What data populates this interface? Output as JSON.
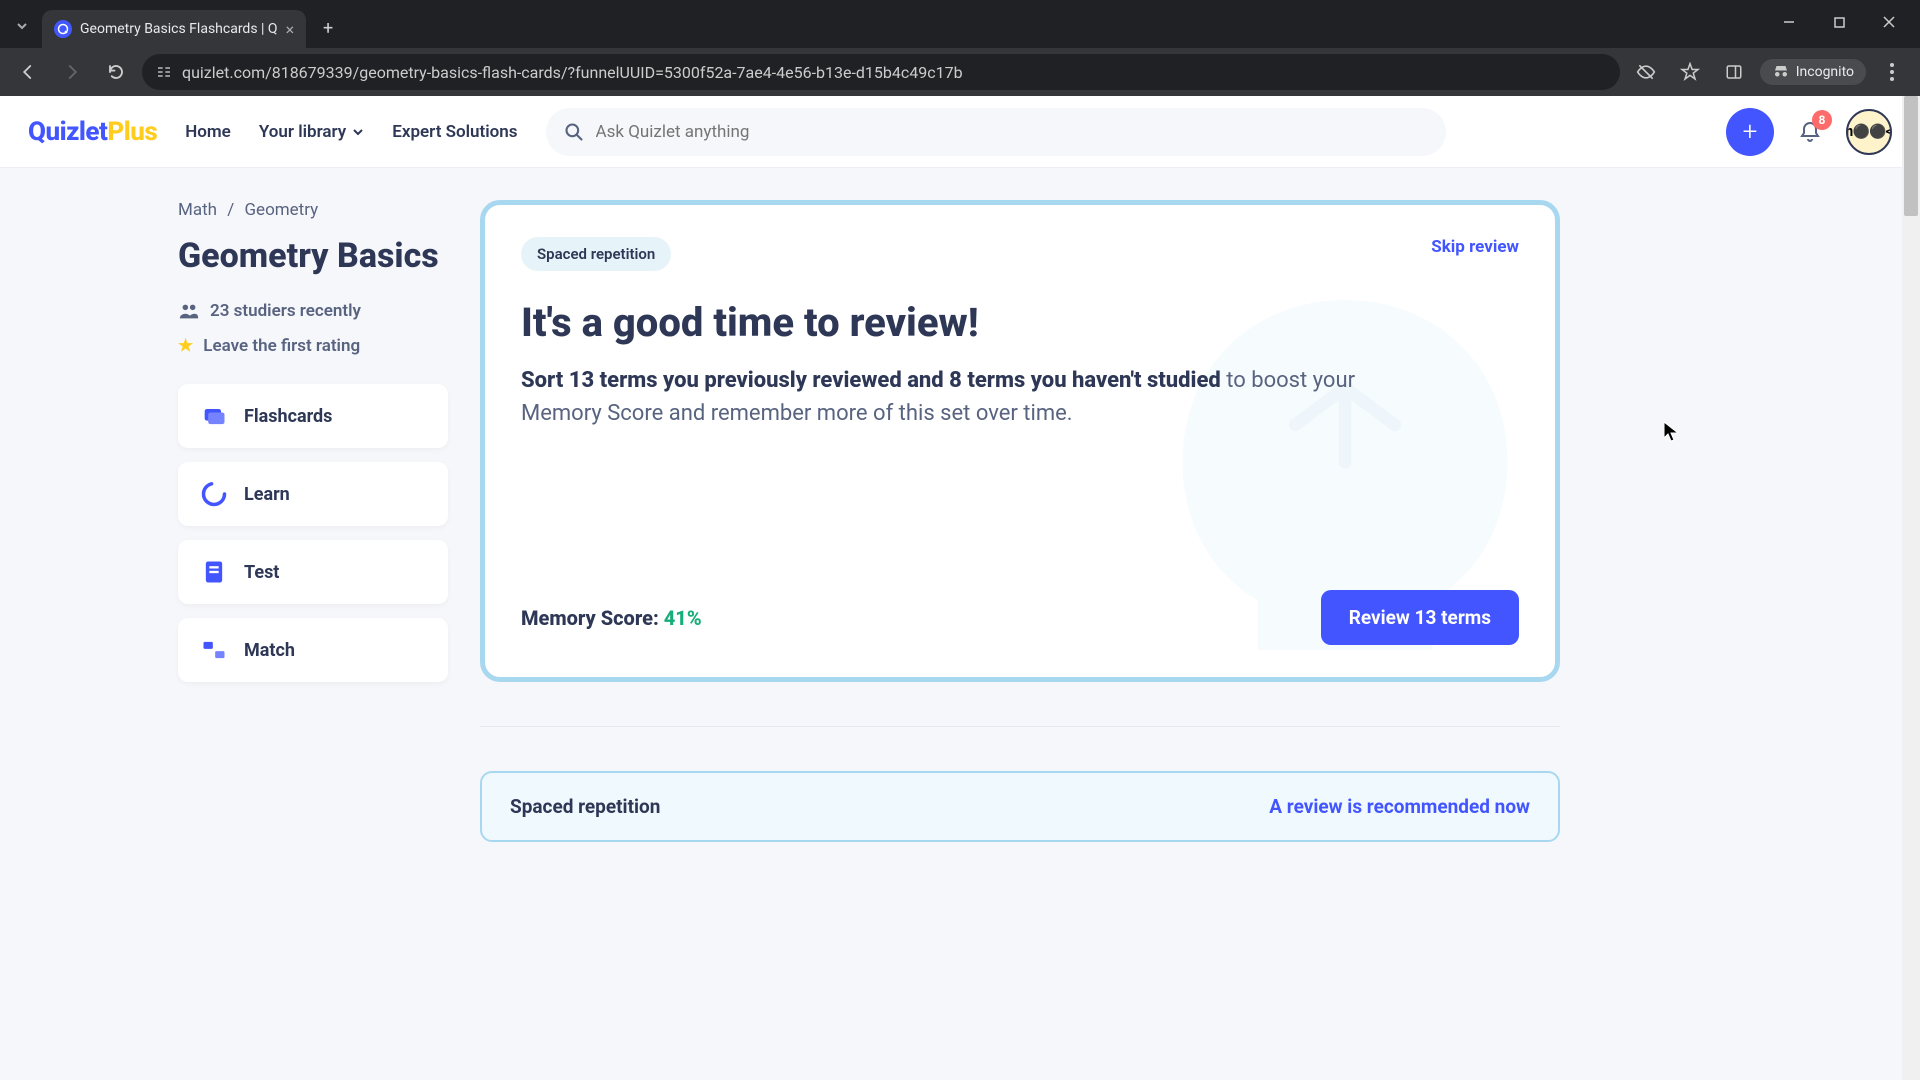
{
  "browser": {
    "tab_title": "Geometry Basics Flashcards | Q",
    "url": "quizlet.com/818679339/geometry-basics-flash-cards/?funnelUUID=5300f52a-7ae4-4e56-b13e-d15b4c49c17b",
    "incognito_label": "Incognito"
  },
  "header": {
    "logo_main": "Quizlet",
    "logo_suffix": "Plus",
    "nav": {
      "home": "Home",
      "library": "Your library",
      "expert": "Expert Solutions"
    },
    "search_placeholder": "Ask Quizlet anything",
    "notification_count": "8"
  },
  "breadcrumb": {
    "root": "Math",
    "sep": "/",
    "leaf": "Geometry"
  },
  "page_title": "Geometry Basics",
  "meta": {
    "studiers": "23 studiers recently",
    "rating": "Leave the first rating"
  },
  "study_modes": {
    "flashcards": "Flashcards",
    "learn": "Learn",
    "test": "Test",
    "match": "Match"
  },
  "review": {
    "chip": "Spaced repetition",
    "skip": "Skip review",
    "title": "It's a good time to review!",
    "desc_bold": "Sort 13 terms you previously reviewed and 8 terms you haven't studied",
    "desc_rest": " to boost your Memory Score and remember more of this set over time.",
    "score_label": "Memory Score: ",
    "score_value": "41%",
    "button": "Review 13 terms"
  },
  "banner": {
    "left": "Spaced repetition",
    "right": "A review is recommended now"
  }
}
